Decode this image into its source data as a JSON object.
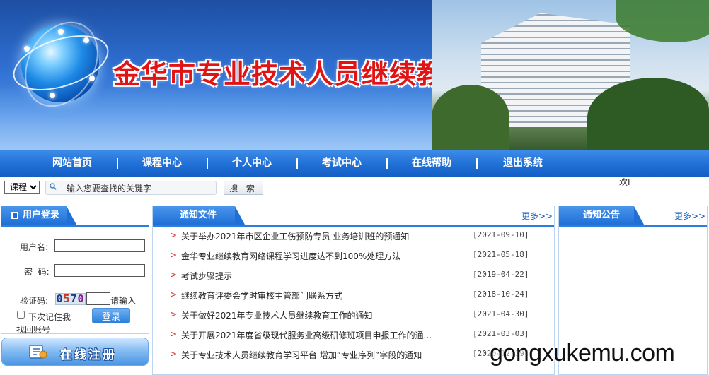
{
  "banner": {
    "title": "金华市专业技术人员继续教育学习平台"
  },
  "nav": {
    "items": [
      {
        "label": "网站首页"
      },
      {
        "label": "课程中心"
      },
      {
        "label": "个人中心"
      },
      {
        "label": "考试中心"
      },
      {
        "label": "在线帮助"
      },
      {
        "label": "退出系统"
      }
    ]
  },
  "search": {
    "category_value": "课程",
    "placeholder": "输入您要查找的关键字",
    "button_label": "搜 索"
  },
  "welcome_text": "欢I",
  "login": {
    "header": "用户登录",
    "username_label": "用户名:",
    "password_label": "密  码:",
    "captcha_label": "验证码:",
    "captcha_chars": [
      "0",
      "5",
      "7",
      "0"
    ],
    "captcha_hint": "请输入",
    "remember_label": "下次记住我",
    "recover_label": "找回账号",
    "login_button": "登录"
  },
  "register": {
    "label": "在线注册",
    "icon": "register-icon"
  },
  "notices": {
    "header": "通知文件",
    "more_label": "更多>>",
    "items": [
      {
        "title": "关于举办2021年市区企业工伤预防专员 业务培训班的预通知",
        "date": "[2021-09-10]"
      },
      {
        "title": "金华专业继续教育网络课程学习进度达不到100%处理方法",
        "date": "[2021-05-18]"
      },
      {
        "title": "考试步骤提示",
        "date": "[2019-04-22]"
      },
      {
        "title": "继续教育评委会学时审核主管部门联系方式",
        "date": "[2018-10-24]"
      },
      {
        "title": "关于做好2021年专业技术人员继续教育工作的通知",
        "date": "[2021-04-30]"
      },
      {
        "title": "关于开展2021年度省级现代服务业高级研修班项目申报工作的通...",
        "date": "[2021-03-03]"
      },
      {
        "title": "关于专业技术人员继续教育学习平台 增加“专业序列”字段的通知",
        "date": "[2020-12-29]"
      }
    ]
  },
  "announcements": {
    "header": "通知公告",
    "more_label": "更多>>"
  },
  "watermark": "gongxukemu.com",
  "colors": {
    "nav_blue": "#1f6fd6",
    "title_red": "#e01414",
    "accent_blue": "#2d7de0",
    "arrow_red": "#d02020"
  }
}
